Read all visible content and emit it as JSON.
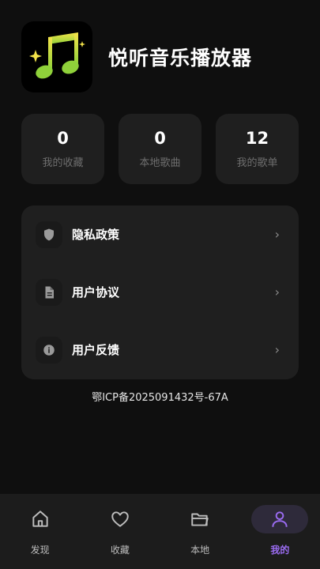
{
  "app": {
    "title": "悦听音乐播放器",
    "icon": "music-note-icon"
  },
  "stats": [
    {
      "value": "0",
      "label": "我的收藏"
    },
    {
      "value": "0",
      "label": "本地歌曲"
    },
    {
      "value": "12",
      "label": "我的歌单"
    }
  ],
  "menu": [
    {
      "label": "隐私政策",
      "icon": "shield-icon"
    },
    {
      "label": "用户协议",
      "icon": "document-icon"
    },
    {
      "label": "用户反馈",
      "icon": "info-icon"
    }
  ],
  "icp": "鄂ICP备2025091432号-67A",
  "tabs": [
    {
      "label": "发现",
      "icon": "home-icon",
      "active": false
    },
    {
      "label": "收藏",
      "icon": "heart-icon",
      "active": false
    },
    {
      "label": "本地",
      "icon": "folder-icon",
      "active": false
    },
    {
      "label": "我的",
      "icon": "person-icon",
      "active": true
    }
  ],
  "colors": {
    "accent": "#9b6cf2",
    "note_yellow": "#f2e24a",
    "note_green": "#8fd13a"
  }
}
